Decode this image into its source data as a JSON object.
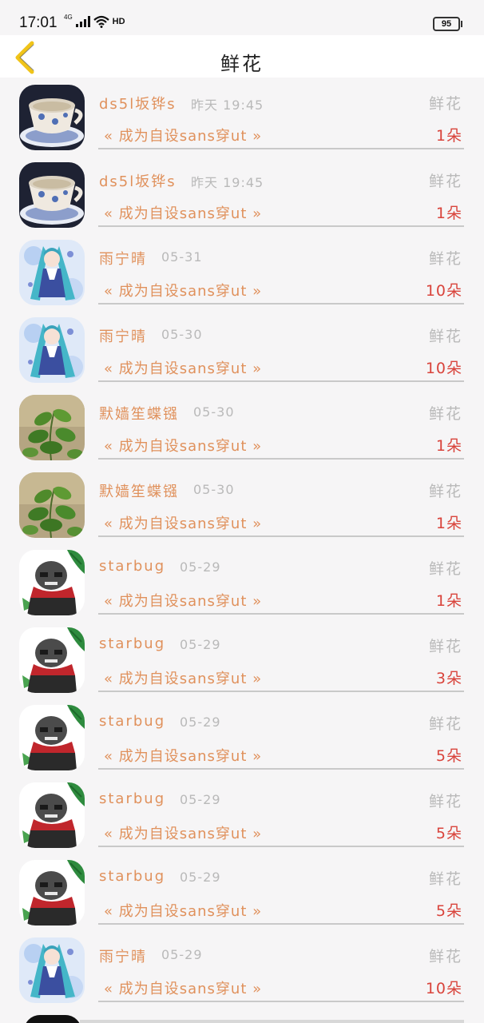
{
  "status_bar": {
    "time": "17:01",
    "network": "4G",
    "hd": "HD",
    "battery": "95"
  },
  "header": {
    "title": "鲜花",
    "back_icon": "chevron-left-icon",
    "accent_color": "#f0c419"
  },
  "colors": {
    "name": "#e0915c",
    "muted": "#b9b9b9",
    "amount": "#d9443c"
  },
  "records": [
    {
      "user": "ds5l坂铧s",
      "time": "昨天 19:45",
      "type": "鲜花",
      "book": "« 成为自设sans穿ut »",
      "amount": "1朵",
      "avatar": "teacup"
    },
    {
      "user": "ds5l坂铧s",
      "time": "昨天 19:45",
      "type": "鲜花",
      "book": "« 成为自设sans穿ut »",
      "amount": "1朵",
      "avatar": "teacup"
    },
    {
      "user": "雨宁晴",
      "time": "05-31",
      "type": "鲜花",
      "book": "« 成为自设sans穿ut »",
      "amount": "10朵",
      "avatar": "anime-girl"
    },
    {
      "user": "雨宁晴",
      "time": "05-30",
      "type": "鲜花",
      "book": "« 成为自设sans穿ut »",
      "amount": "10朵",
      "avatar": "anime-girl"
    },
    {
      "user": "默嫱笙蝶镪",
      "time": "05-30",
      "type": "鲜花",
      "book": "« 成为自设sans穿ut »",
      "amount": "1朵",
      "avatar": "plant"
    },
    {
      "user": "默嫱笙蝶镪",
      "time": "05-30",
      "type": "鲜花",
      "book": "« 成为自设sans穿ut »",
      "amount": "1朵",
      "avatar": "plant"
    },
    {
      "user": "starbug",
      "time": "05-29",
      "type": "鲜花",
      "book": "« 成为自设sans穿ut »",
      "amount": "1朵",
      "avatar": "skeleton"
    },
    {
      "user": "starbug",
      "time": "05-29",
      "type": "鲜花",
      "book": "« 成为自设sans穿ut »",
      "amount": "3朵",
      "avatar": "skeleton"
    },
    {
      "user": "starbug",
      "time": "05-29",
      "type": "鲜花",
      "book": "« 成为自设sans穿ut »",
      "amount": "5朵",
      "avatar": "skeleton"
    },
    {
      "user": "starbug",
      "time": "05-29",
      "type": "鲜花",
      "book": "« 成为自设sans穿ut »",
      "amount": "5朵",
      "avatar": "skeleton"
    },
    {
      "user": "starbug",
      "time": "05-29",
      "type": "鲜花",
      "book": "« 成为自设sans穿ut »",
      "amount": "5朵",
      "avatar": "skeleton"
    },
    {
      "user": "雨宁晴",
      "time": "05-29",
      "type": "鲜花",
      "book": "« 成为自设sans穿ut »",
      "amount": "10朵",
      "avatar": "anime-girl"
    }
  ]
}
